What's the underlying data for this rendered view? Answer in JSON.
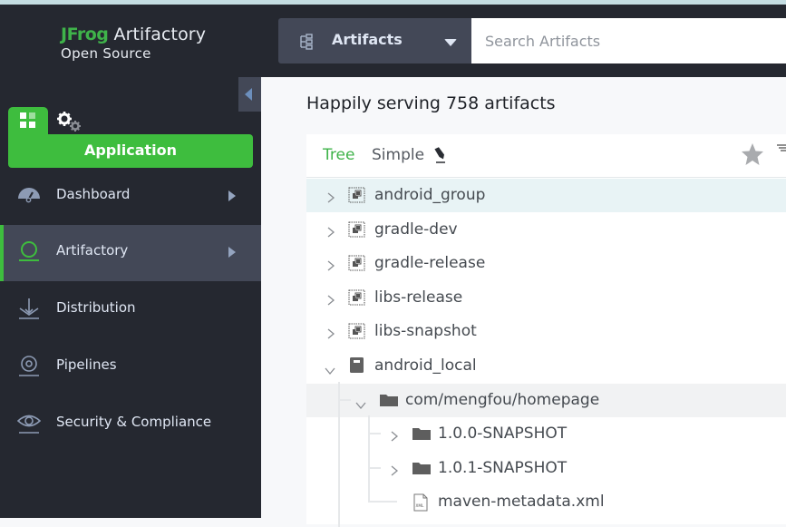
{
  "brand": {
    "name_prefix": "JFrog",
    "name_suffix": " Artifactory",
    "edition": "Open Source"
  },
  "header": {
    "package_selector_label": "Artifacts",
    "search_placeholder": "Search Artifacts",
    "search_value": ""
  },
  "sidebar": {
    "tabs": [
      {
        "icon": "grid-icon",
        "label": "Application",
        "active": true
      },
      {
        "icon": "gears-icon",
        "label": "Administration",
        "active": false
      }
    ],
    "application_label": "Application",
    "items": [
      {
        "label": "Dashboard",
        "icon": "gauge-icon",
        "has_arrow": true,
        "active": false
      },
      {
        "label": "Artifactory",
        "icon": "artifactory-icon",
        "has_arrow": true,
        "active": true
      },
      {
        "label": "Distribution",
        "icon": "distribution-icon",
        "has_arrow": false,
        "active": false
      },
      {
        "label": "Pipelines",
        "icon": "pipelines-icon",
        "has_arrow": false,
        "active": false
      },
      {
        "label": "Security & Compliance",
        "icon": "eye-icon",
        "has_arrow": false,
        "active": false
      }
    ]
  },
  "main": {
    "title": "Happily serving 758 artifacts",
    "view_tabs": [
      {
        "label": "Tree",
        "active": true
      },
      {
        "label": "Simple",
        "active": false
      }
    ],
    "tree": [
      {
        "label": "android_group",
        "type": "virtual-repo",
        "depth": 0,
        "expanded": false,
        "highlighted": true
      },
      {
        "label": "gradle-dev",
        "type": "virtual-repo",
        "depth": 0,
        "expanded": false
      },
      {
        "label": "gradle-release",
        "type": "virtual-repo",
        "depth": 0,
        "expanded": false
      },
      {
        "label": "libs-release",
        "type": "virtual-repo",
        "depth": 0,
        "expanded": false
      },
      {
        "label": "libs-snapshot",
        "type": "virtual-repo",
        "depth": 0,
        "expanded": false
      },
      {
        "label": "android_local",
        "type": "local-repo",
        "depth": 0,
        "expanded": true
      },
      {
        "label": "com/mengfou/homepage",
        "type": "folder",
        "depth": 1,
        "expanded": true,
        "selected": true
      },
      {
        "label": "1.0.0-SNAPSHOT",
        "type": "folder",
        "depth": 2,
        "expanded": false
      },
      {
        "label": "1.0.1-SNAPSHOT",
        "type": "folder",
        "depth": 2,
        "expanded": false
      },
      {
        "label": "maven-metadata.xml",
        "type": "xml-file",
        "depth": 2,
        "leaf": true
      }
    ]
  },
  "colors": {
    "brand_green": "#3ebd3e",
    "sidebar_bg": "#252830",
    "active_item_bg": "#434857",
    "highlight_row": "#e8f3f5"
  }
}
